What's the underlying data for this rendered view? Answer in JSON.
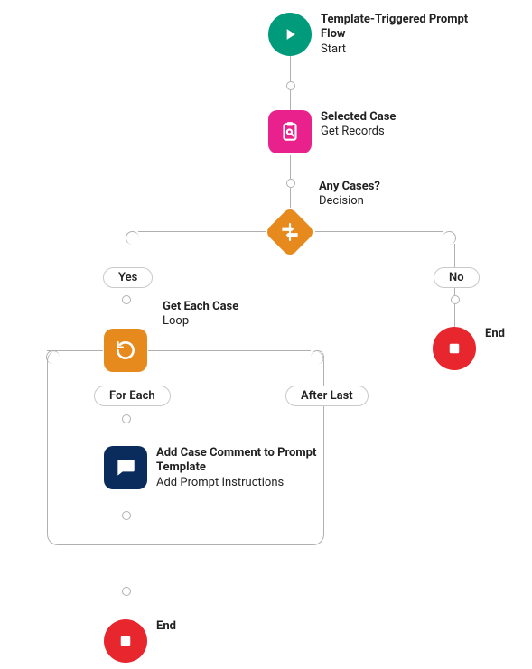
{
  "colors": {
    "start": "#009b7a",
    "getRecords": "#e9218d",
    "decision": "#e78a1e",
    "loop": "#e78a1e",
    "prompt": "#092c5c",
    "end": "#e7262e"
  },
  "nodes": {
    "start": {
      "title": "Template-Triggered Prompt Flow",
      "subtitle": "Start"
    },
    "selectedCase": {
      "title": "Selected Case",
      "subtitle": "Get Records"
    },
    "anyCases": {
      "title": "Any Cases?",
      "subtitle": "Decision"
    },
    "getEachCase": {
      "title": "Get Each Case",
      "subtitle": "Loop"
    },
    "addComment": {
      "title": "Add Case Comment to Prompt Template",
      "subtitle": "Add Prompt Instructions"
    },
    "endYesBranch": {
      "title": "End"
    },
    "endNoBranch": {
      "title": "End"
    }
  },
  "branches": {
    "yes": "Yes",
    "no": "No",
    "forEach": "For Each",
    "afterLast": "After Last"
  }
}
